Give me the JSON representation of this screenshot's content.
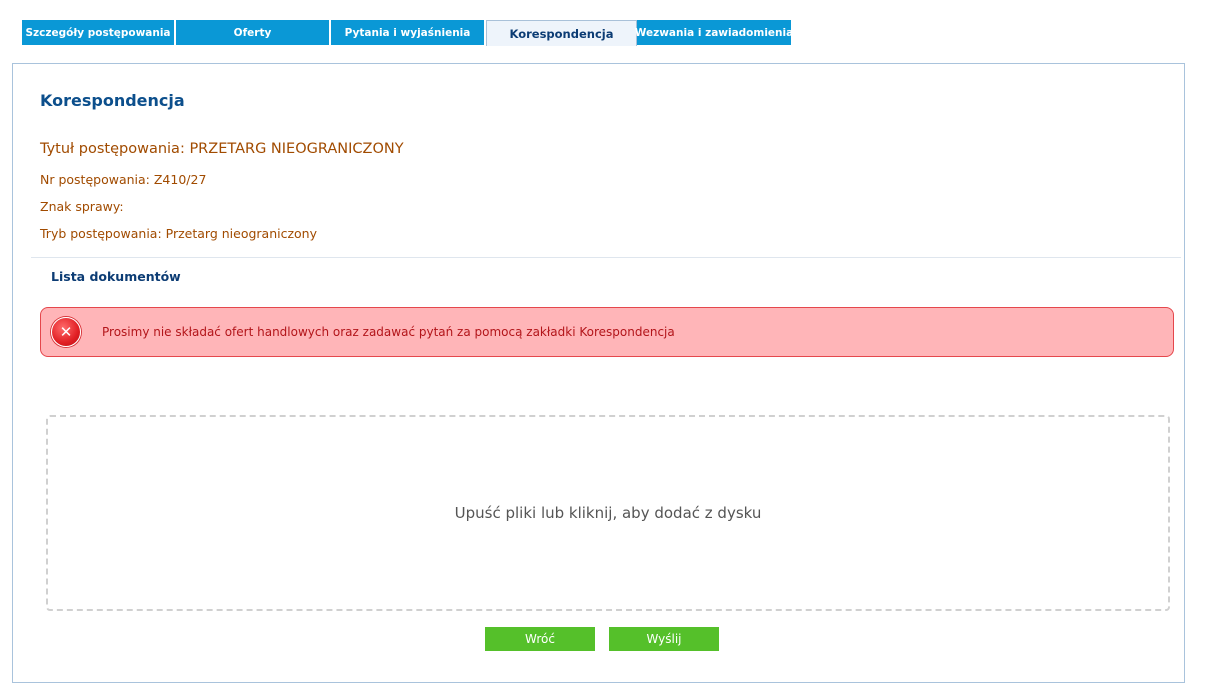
{
  "tabs": [
    {
      "label": "Szczegóły postępowania"
    },
    {
      "label": "Oferty"
    },
    {
      "label": "Pytania i wyjaśnienia"
    },
    {
      "label": "Korespondencja",
      "active": true
    },
    {
      "label": "Wezwania i zawiadomienia"
    }
  ],
  "page": {
    "title": "Korespondencja",
    "procedure_title": "Tytuł postępowania: PRZETARG NIEOGRANICZONY",
    "procedure_number": "Nr postępowania: Z410/27",
    "case_mark": "Znak sprawy:",
    "procedure_mode": "Tryb postępowania: Przetarg nieograniczony"
  },
  "documents": {
    "heading": "Lista dokumentów"
  },
  "alert": {
    "icon": "close-circle-icon",
    "symbol": "✕",
    "text": "Prosimy nie składać ofert handlowych oraz zadawać pytań za pomocą zakładki Korespondencja"
  },
  "dropzone": {
    "text": "Upuść pliki lub kliknij, aby dodać z dysku"
  },
  "buttons": {
    "back": "Wróć",
    "send": "Wyślij"
  },
  "colors": {
    "tab": "#0a98d6",
    "tab_active": "#eef4fb",
    "heading": "#0c4f8c",
    "meta_text": "#a14b00",
    "alert_bg": "#ffb5b8",
    "alert_border": "#e5474c",
    "button": "#55c02a"
  }
}
